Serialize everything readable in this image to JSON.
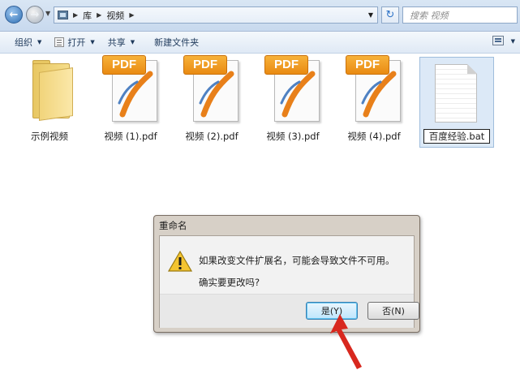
{
  "address_bar": {
    "breadcrumbs": [
      "库",
      "视频"
    ],
    "search_placeholder": "搜索 视频"
  },
  "command_bar": {
    "organize_label": "组织",
    "open_label": "打开",
    "share_label": "共享",
    "new_folder_label": "新建文件夹"
  },
  "files": [
    {
      "name": "示例视频",
      "type": "folder"
    },
    {
      "name": "视频 (1).pdf",
      "type": "pdf",
      "badge": "PDF"
    },
    {
      "name": "视频 (2).pdf",
      "type": "pdf",
      "badge": "PDF"
    },
    {
      "name": "视频 (3).pdf",
      "type": "pdf",
      "badge": "PDF"
    },
    {
      "name": "视频 (4).pdf",
      "type": "pdf",
      "badge": "PDF"
    },
    {
      "name": "百度经验.bat",
      "type": "bat",
      "state": "renaming"
    }
  ],
  "dialog": {
    "title": "重命名",
    "message": "如果改变文件扩展名，可能会导致文件不可用。",
    "question": "确实要更改吗?",
    "yes_label": "是(Y)",
    "no_label": "否(N)"
  },
  "colors": {
    "annotation_arrow": "#d8281e",
    "pdf_badge": "#f09a1f",
    "selection": "#dce9f7"
  }
}
